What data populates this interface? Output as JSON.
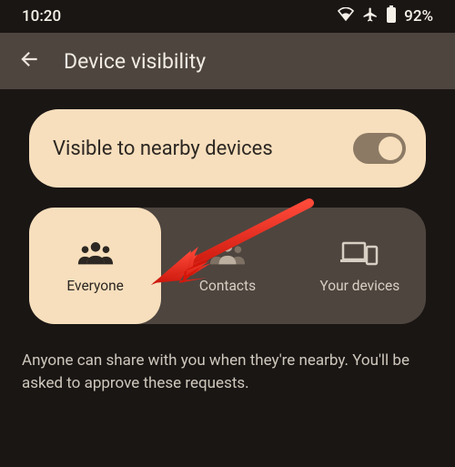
{
  "statusbar": {
    "time": "10:20",
    "battery": "92%"
  },
  "appbar": {
    "title": "Device visibility"
  },
  "visibility_card": {
    "title": "Visible to nearby devices",
    "enabled": true
  },
  "options": {
    "items": [
      {
        "label": "Everyone",
        "selected": true
      },
      {
        "label": "Contacts",
        "selected": false
      },
      {
        "label": "Your devices",
        "selected": false
      }
    ]
  },
  "description": "Anyone can share with you when they're nearby. You'll be asked to approve these requests."
}
